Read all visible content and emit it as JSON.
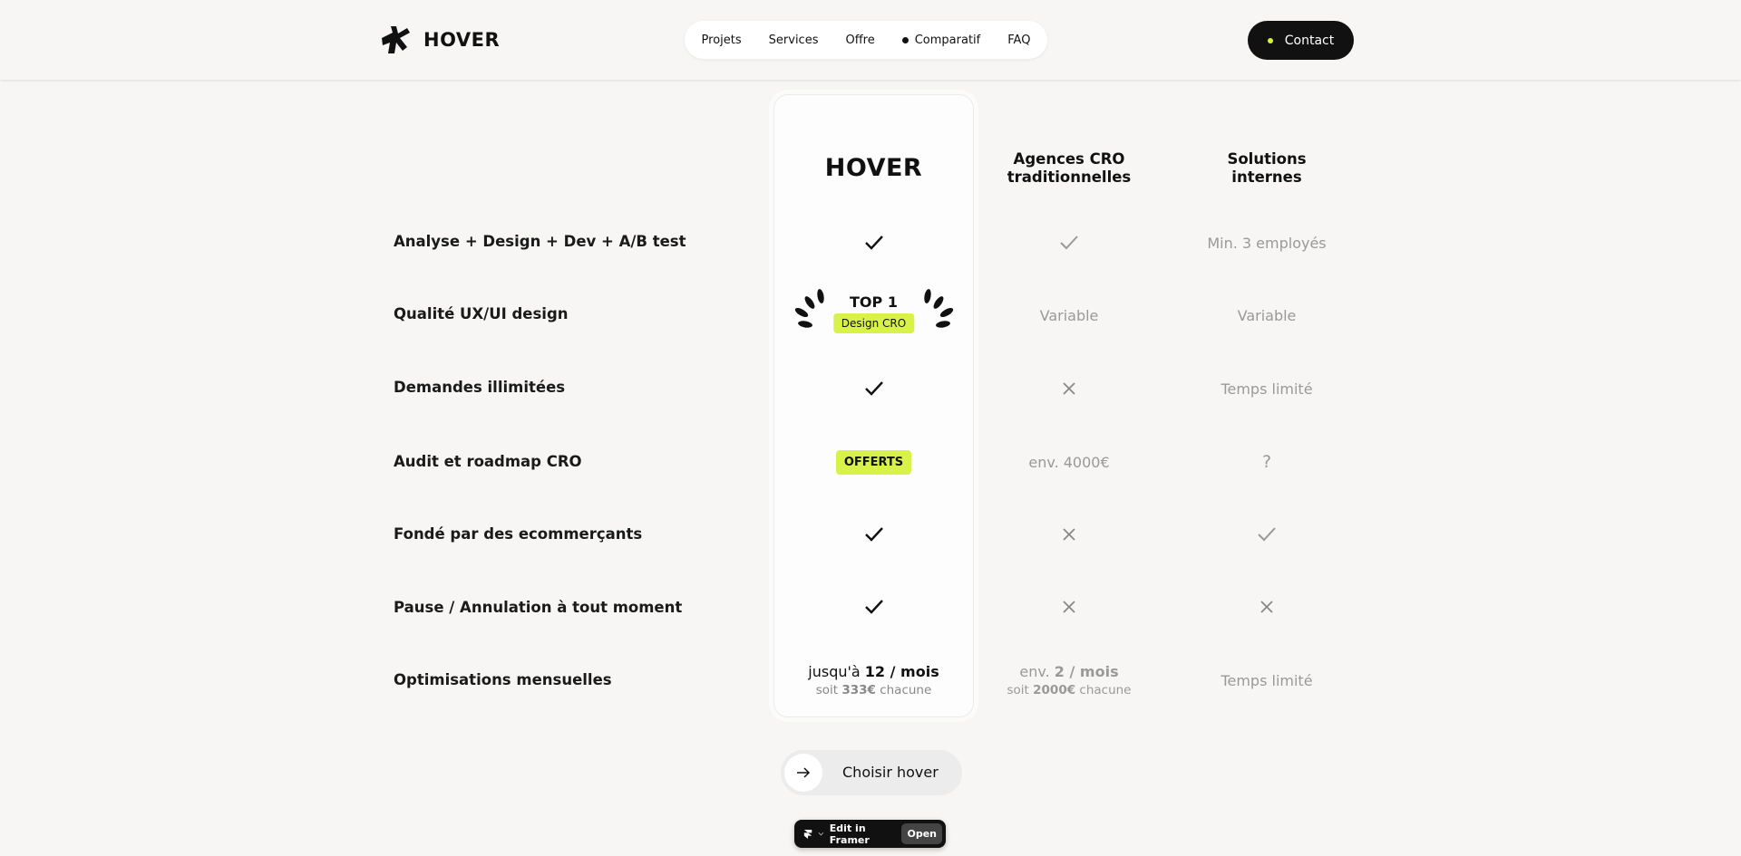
{
  "header": {
    "brand": "HOVER",
    "nav": [
      {
        "label": "Projets"
      },
      {
        "label": "Services"
      },
      {
        "label": "Offre"
      },
      {
        "label": "Comparatif"
      },
      {
        "label": "FAQ"
      }
    ],
    "contact_label": "Contact",
    "accent_color": "#d6f33a"
  },
  "columns": {
    "hover": "HOVER",
    "agences_line1": "Agences CRO",
    "agences_line2": "traditionnelles",
    "internes_line1": "Solutions",
    "internes_line2": "internes"
  },
  "rows": {
    "r1": {
      "label": "Analyse + Design + Dev + A/B test",
      "hover": "check-icon",
      "agences": "check-icon",
      "internes_text": "Min. 3 employés"
    },
    "r2": {
      "label": "Qualité UX/UI design",
      "hover_top": "TOP 1",
      "hover_badge": "Design CRO",
      "agences_text": "Variable",
      "internes_text": "Variable"
    },
    "r3": {
      "label": "Demandes illimitées",
      "hover": "check-icon",
      "agences": "cross-icon",
      "internes_text": "Temps limité"
    },
    "r4": {
      "label": "Audit et roadmap CRO",
      "hover_badge": "OFFERTS",
      "agences_text": "env. 4000€",
      "internes_text": "?"
    },
    "r5": {
      "label": "Fondé par des ecommerçants",
      "hover": "check-icon",
      "agences": "cross-icon",
      "internes": "check-icon"
    },
    "r6": {
      "label": "Pause / Annulation à tout moment",
      "hover": "check-icon",
      "agences": "cross-icon",
      "internes": "cross-icon"
    },
    "r7": {
      "label": "Optimisations mensuelles",
      "hover_prefix": "jusqu'à ",
      "hover_value": "12 / mois",
      "hover_sub_prefix": "soit ",
      "hover_sub_value": "333€",
      "hover_sub_suffix": " chacune",
      "agences_prefix": "env. ",
      "agences_value": "2 / mois",
      "agences_sub_prefix": "soit ",
      "agences_sub_value": "2000€",
      "agences_sub_suffix": " chacune",
      "internes_text": "Temps limité"
    }
  },
  "cta": {
    "label": "Choisir hover"
  },
  "framer": {
    "edit_label": "Edit in Framer",
    "open_label": "Open"
  }
}
